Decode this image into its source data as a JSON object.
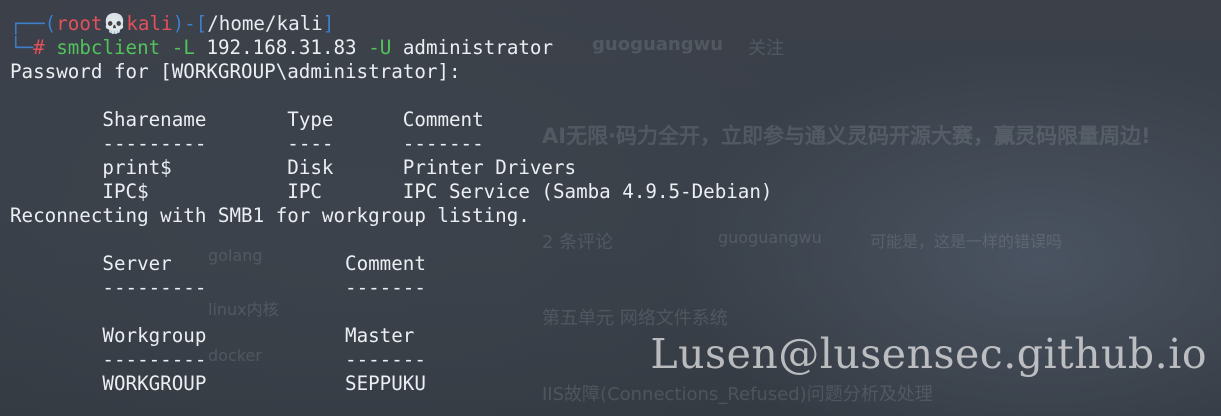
{
  "terminal": {
    "prompt": {
      "user": "root",
      "skull": "💀",
      "host": "kali",
      "path": "/home/kali",
      "symbol": "#"
    },
    "command": {
      "program": "smbclient",
      "flag1": "-L",
      "ip": "192.168.31.83",
      "flag2": "-U",
      "user_arg": "administrator"
    },
    "password_prompt": "Password for [WORKGROUP\\administrator]:",
    "shares_table": {
      "headers": [
        "Sharename",
        "Type",
        "Comment"
      ],
      "underlines": [
        "---------",
        "----",
        "-------"
      ],
      "rows": [
        [
          "print$",
          "Disk",
          "Printer Drivers"
        ],
        [
          "IPC$",
          "IPC",
          "IPC Service (Samba 4.9.5-Debian)"
        ]
      ]
    },
    "reconnect_message": "Reconnecting with SMB1 for workgroup listing.",
    "server_table": {
      "headers": [
        "Server",
        "Comment"
      ],
      "underlines": [
        "---------",
        "-------"
      ]
    },
    "workgroup_table": {
      "headers": [
        "Workgroup",
        "Master"
      ],
      "underlines": [
        "---------",
        "-------"
      ],
      "rows": [
        [
          "WORKGROUP",
          "SEPPUKU"
        ]
      ]
    }
  },
  "watermark": "Lusen@lusensec.github.io",
  "background": {
    "faint_texts": [
      "guoguangwu",
      "关注",
      "AI无限·码力全开，立即参与通义灵码开源大赛，赢灵码限量周边!",
      "2 条评论",
      "guoguangwu",
      "可能是，这是一样的错误吗",
      "golang",
      "第五单元 网络文件系统",
      "IIS故障(Connections_Refused)问题分析及处理",
      "docker",
      "linux内核"
    ]
  }
}
